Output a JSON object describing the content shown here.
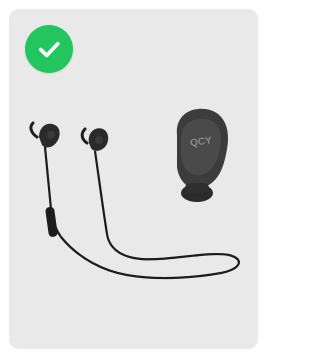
{
  "card": {
    "state": "selected",
    "background_color": "#e9e9e9"
  },
  "badge": {
    "icon": "checkmark-icon",
    "color": "#22c55e"
  },
  "product": {
    "items": [
      {
        "icon": "neckband-earphones-icon"
      },
      {
        "icon": "single-earbud-icon"
      }
    ]
  }
}
